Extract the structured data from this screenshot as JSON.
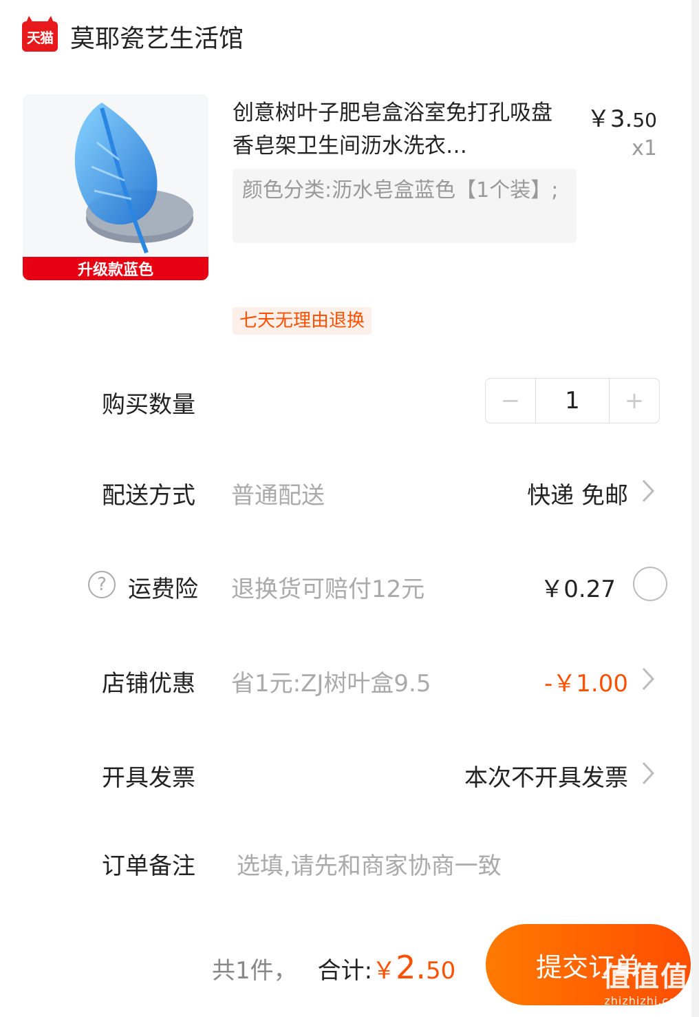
{
  "shop": {
    "badge": "天猫",
    "name": "莫耶瓷艺生活馆"
  },
  "product": {
    "thumb_tag": "升级款蓝色",
    "title": "创意树叶子肥皂盒浴室免打孔吸盘香皂架卫生间沥水洗衣…",
    "price_main": "￥3.",
    "price_decimal": "50",
    "quantity_label": "x1",
    "sku": "颜色分类:沥水皂盒蓝色【1个装】;",
    "return_tag": "七天无理由退换"
  },
  "quantity_row": {
    "label": "购买数量",
    "minus": "−",
    "value": "1",
    "plus": "+"
  },
  "delivery_row": {
    "label": "配送方式",
    "sub": "普通配送",
    "value": "快递 免邮"
  },
  "insurance_row": {
    "help": "?",
    "label": "运费险",
    "sub": "退换货可赔付12元",
    "value": "￥0.27"
  },
  "discount_row": {
    "label": "店铺优惠",
    "sub": "省1元:ZJ树叶盒9.5",
    "value": "-￥1.00"
  },
  "invoice_row": {
    "label": "开具发票",
    "value": "本次不开具发票"
  },
  "note_row": {
    "label": "订单备注",
    "placeholder": "选填,请先和商家协商一致"
  },
  "footer": {
    "count": "共1件，",
    "total_label": "合计:",
    "currency": "￥",
    "total_int": "2.",
    "total_dec": "50",
    "submit": "提交订单"
  },
  "watermark": {
    "main": "值值值",
    "sub": "zhizhizhi.com"
  },
  "colors": {
    "accent": "#ff5000",
    "tmall_red": "#e8191c"
  }
}
